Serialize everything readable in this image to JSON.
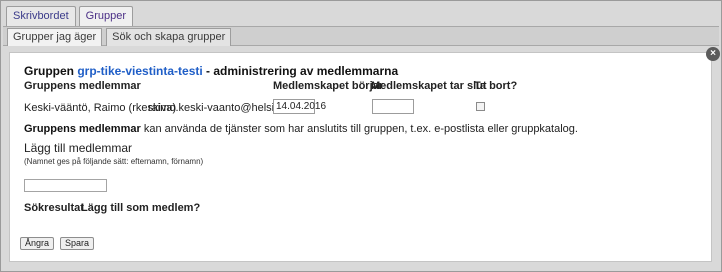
{
  "tabs": [
    {
      "label": "Skrivbordet",
      "active": false
    },
    {
      "label": "Grupper",
      "active": true
    }
  ],
  "subtabs": [
    {
      "label": "Grupper jag äger",
      "active": true
    },
    {
      "label": "Sök och skapa grupper",
      "active": false
    }
  ],
  "panel": {
    "close_icon": "×",
    "title_prefix": "Gruppen",
    "group_name": "grp-tike-viestinta-testi",
    "title_suffix": "- administrering av medlemmarna",
    "columns": {
      "members": "Gruppens medlemmar",
      "start": "Medlemskapet börjar",
      "end": "Medlemskapet tar slut",
      "remove": "Ta bort?"
    },
    "member": {
      "name": "Keski-vääntö, Raimo (rkeskiva)",
      "email": "raimo.keski-vaanto@helsinki.fi",
      "start_date": "14.04.2016",
      "end_date": "",
      "remove_checked": false
    },
    "note_bold": "Gruppens medlemmar",
    "note_text": "kan använda de tjänster som har anslutits till gruppen, t.ex. e-postlista eller gruppkatalog.",
    "add_heading": "Lägg till medlemmar",
    "add_hint": "(Namnet ges på följande sätt: efternamn, förnamn)",
    "add_input_value": "",
    "results_label": "Sökresultat",
    "add_as_member_label": "Lägg till som medlem?",
    "cancel_label": "Ångra",
    "save_label": "Spara"
  }
}
